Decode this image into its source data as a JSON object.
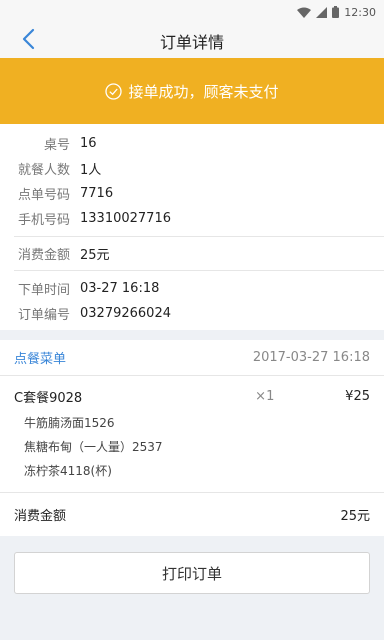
{
  "status_bar": {
    "time": "12:30",
    "wifi_icon": "wifi-icon",
    "signal_icon": "signal-icon",
    "battery_icon": "battery-icon"
  },
  "nav": {
    "title": "订单详情",
    "back_icon": "back-chevron-icon"
  },
  "banner": {
    "text": "接单成功，顾客未支付",
    "icon": "check-circle-icon",
    "color": "#f0b022"
  },
  "info": {
    "table": {
      "label": "桌号",
      "value": "16"
    },
    "diners": {
      "label": "就餐人数",
      "value": "1人"
    },
    "order_code": {
      "label": "点单号码",
      "value": "7716"
    },
    "phone": {
      "label": "手机号码",
      "value": "13310027716"
    },
    "amount": {
      "label": "消费金额",
      "value": "25元"
    },
    "order_time": {
      "label": "下单时间",
      "value": "03-27 16:18"
    },
    "order_no": {
      "label": "订单编号",
      "value": "03279266024"
    }
  },
  "menu": {
    "title": "点餐菜单",
    "time": "2017-03-27 16:18",
    "item": {
      "name": "C套餐9028",
      "qty": "×1",
      "price": "¥25"
    },
    "sub_items": [
      "牛筋腩汤面1526",
      "焦糖布甸（一人量）2537",
      "冻柠茶4118(杯)"
    ],
    "total_label": "消费金额",
    "total_value": "25元"
  },
  "print_button": "打印订单",
  "colors": {
    "accent": "#3a86d8",
    "banner": "#f0b022"
  }
}
